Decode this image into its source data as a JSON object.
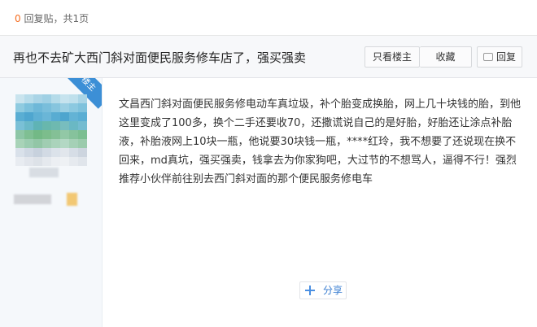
{
  "top_bar": {
    "reply_count": "0",
    "reply_count_suffix": "回复贴，共",
    "page_count": "1",
    "page_suffix": "页"
  },
  "thread": {
    "title": "再也不去矿大西门斜对面便民服务修车店了，强买强卖",
    "buttons": {
      "only_owner": "只看楼主",
      "favorite": "收藏",
      "reply": "回复"
    }
  },
  "post": {
    "badge": "楼主",
    "content": "文昌西门斜对面便民服务修电动车真垃圾，补个胎变成换胎，网上几十块钱的胎，到他这里变成了100多，换个二手还要收70，还撒谎说自己的是好胎，好胎还让涂点补胎液，补胎液网上10块一瓶，他说要30块钱一瓶，****红玲，我不想要了还说现在换不回来，md真坑，强买强卖，钱拿去为你家狗吧，大过节的不想骂人，逼得不行！强烈推荐小伙伴前往别去西门斜对面的那个便民服务修电车",
    "share_label": "分享"
  },
  "colors": {
    "accent": "#3c8fd6",
    "count": "#f56c1f",
    "author_bg": "#f5f8fb"
  },
  "icons": {
    "reply": "speech-bubble-icon",
    "share": "plus-icon"
  }
}
